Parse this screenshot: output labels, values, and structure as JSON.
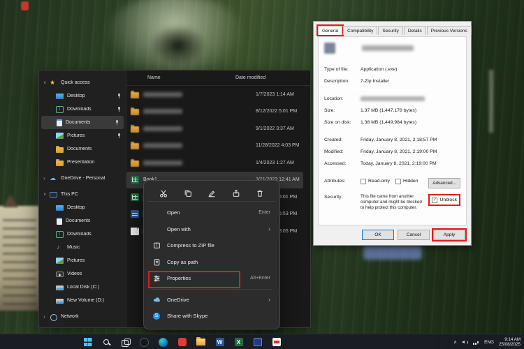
{
  "explorer": {
    "columns": {
      "name": "Name",
      "date_modified": "Date modified"
    },
    "sidebar": {
      "items": [
        {
          "label": "Quick access"
        },
        {
          "label": "Desktop"
        },
        {
          "label": "Downloads"
        },
        {
          "label": "Documents"
        },
        {
          "label": "Pictures"
        },
        {
          "label": "Documents"
        },
        {
          "label": "Presentation"
        },
        {
          "label": "OneDrive - Personal"
        },
        {
          "label": "This PC"
        },
        {
          "label": "Desktop"
        },
        {
          "label": "Documents"
        },
        {
          "label": "Downloads"
        },
        {
          "label": "Music"
        },
        {
          "label": "Pictures"
        },
        {
          "label": "Videos"
        },
        {
          "label": "Local Disk (C:)"
        },
        {
          "label": "New Volume (D:)"
        },
        {
          "label": "Network"
        }
      ]
    },
    "files": [
      {
        "name": "",
        "type": "folder",
        "redacted": true,
        "date": "1/7/2023 1:14 AM"
      },
      {
        "name": "",
        "type": "folder",
        "redacted": true,
        "date": "8/12/2022 5:01 PM"
      },
      {
        "name": "",
        "type": "folder",
        "redacted": true,
        "date": "9/1/2022 3:37 AM"
      },
      {
        "name": "",
        "type": "folder",
        "redacted": true,
        "date": "11/28/2022 4:03 PM"
      },
      {
        "name": "",
        "type": "folder",
        "redacted": true,
        "date": "1/4/2023 1:27 AM"
      },
      {
        "name": "Book1",
        "type": "excel",
        "selected": true,
        "date": "3/21/2023 12:41 AM"
      },
      {
        "name": "",
        "type": "excel",
        "redacted": true,
        "date": "3/21/2023 5:01 PM"
      },
      {
        "name": "",
        "type": "word",
        "redacted": true,
        "date": "3/21/2023 5:53 PM"
      },
      {
        "name": "",
        "type": "file",
        "redacted": true,
        "date": "3/21/2023 3:05 PM"
      }
    ]
  },
  "context_menu": {
    "toolbar_icons": [
      "cut",
      "copy",
      "rename",
      "share",
      "delete"
    ],
    "items": [
      {
        "label": "Open",
        "shortcut": "Enter"
      },
      {
        "label": "Open with"
      },
      {
        "label": "Compress to ZIP file"
      },
      {
        "label": "Copy as path"
      },
      {
        "label": "Properties",
        "shortcut": "Alt+Enter",
        "highlighted": true
      },
      {
        "label": "OneDrive"
      },
      {
        "label": "Share with Skype"
      }
    ]
  },
  "properties_dialog": {
    "tabs": [
      "General",
      "Compatibility",
      "Security",
      "Details",
      "Previous Versions"
    ],
    "active_tab": "General",
    "type_label": "Type of file:",
    "type_value": "Application (.exe)",
    "description_label": "Description:",
    "description_value": "7-Zip Installer",
    "location_label": "Location:",
    "size_label": "Size:",
    "size_value": "1.37 MB (1,447,178 bytes)",
    "size_on_disk_label": "Size on disk:",
    "size_on_disk_value": "1.38 MB (1,449,984 bytes)",
    "created_label": "Created:",
    "created_value": "Friday, January 8, 2021, 2:18:57 PM",
    "modified_label": "Modified:",
    "modified_value": "Friday, January 8, 2021, 2:19:00 PM",
    "accessed_label": "Accessed:",
    "accessed_value": "Today, January 8, 2021, 2:19:00 PM",
    "attributes_label": "Attributes:",
    "readonly_label": "Read-only",
    "hidden_label": "Hidden",
    "advanced_button": "Advanced...",
    "security_label": "Security:",
    "security_text": "This file came from another computer and might be blocked to help protect this computer.",
    "unblock_label": "Unblock",
    "unblock_checked": true,
    "ok_button": "OK",
    "cancel_button": "Cancel",
    "apply_button": "Apply"
  },
  "taskbar": {
    "icons": [
      "start",
      "search",
      "task-view",
      "edge",
      "app-dark",
      "app-red",
      "file-explorer",
      "word",
      "excel",
      "code-app",
      "app-white-red"
    ],
    "tray": {
      "language": "ENG",
      "time": "9:14 AM",
      "date": "25/08/2025"
    }
  },
  "annotation_color": "#e31b1b"
}
